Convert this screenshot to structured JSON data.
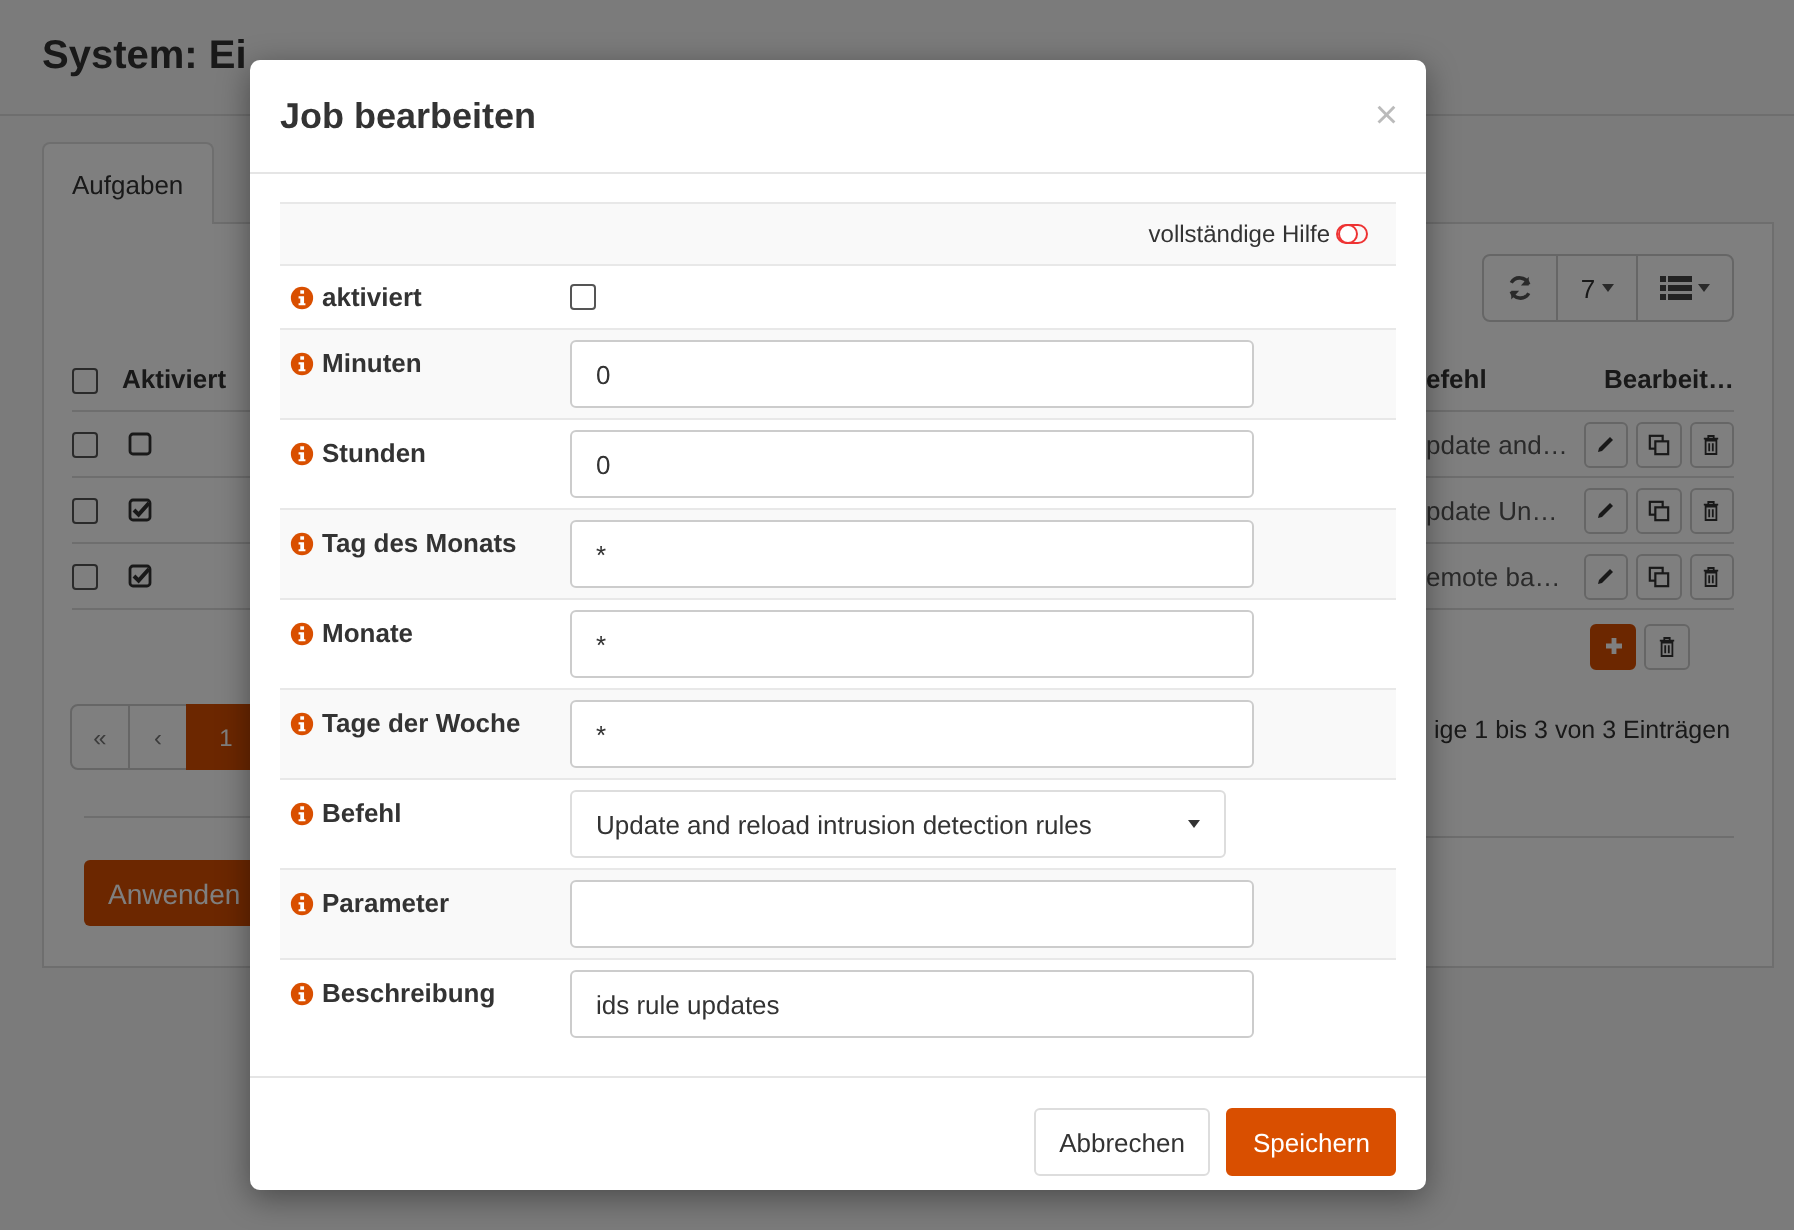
{
  "page": {
    "title": "System: Ei",
    "tabs": [
      {
        "label": "Aufgaben",
        "selected": true
      }
    ],
    "toolbar": {
      "page_size": "7"
    },
    "table": {
      "select_all": false,
      "header_left": "Aktiviert",
      "header_command": "efehl",
      "header_edit": "Bearbeit…",
      "rows": [
        {
          "selected": false,
          "enabled": false,
          "command": "pdate and…"
        },
        {
          "selected": false,
          "enabled": true,
          "command": "pdate Un…"
        },
        {
          "selected": false,
          "enabled": true,
          "command": "emote ba…"
        }
      ]
    },
    "pagination": [
      {
        "label": "«",
        "selected": false
      },
      {
        "label": "‹",
        "selected": false
      },
      {
        "label": "1",
        "selected": true
      }
    ],
    "info": "ige 1 bis 3 von 3 Einträgen",
    "apply_button": "Anwenden"
  },
  "dialog": {
    "title": "Job bearbeiten",
    "close": "×",
    "help_label": "vollständige Hilfe",
    "help_on": false,
    "fields": [
      {
        "kind": "checkbox",
        "label": "aktiviert",
        "checked": false
      },
      {
        "kind": "text",
        "label": "Minuten",
        "value": "0"
      },
      {
        "kind": "text",
        "label": "Stunden",
        "value": "0"
      },
      {
        "kind": "text",
        "label": "Tag des Monats",
        "value": "*"
      },
      {
        "kind": "text",
        "label": "Monate",
        "value": "*"
      },
      {
        "kind": "text",
        "label": "Tage der Woche",
        "value": "*"
      },
      {
        "kind": "select",
        "label": "Befehl",
        "value": "Update and reload intrusion detection rules"
      },
      {
        "kind": "text",
        "label": "Parameter"
      },
      {
        "kind": "text",
        "label": "Beschreibung",
        "value": "ids rule updates"
      }
    ],
    "buttons": [
      {
        "label": "Abbrechen",
        "kind": "default"
      },
      {
        "label": "Speichern",
        "kind": "primary"
      }
    ]
  }
}
